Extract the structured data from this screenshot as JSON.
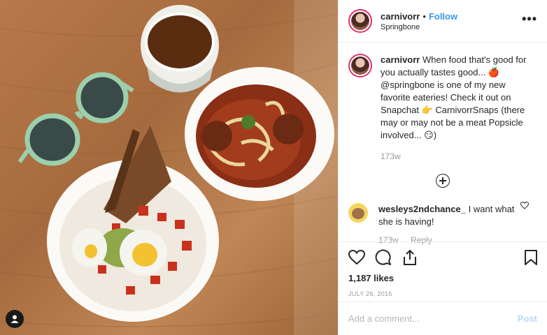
{
  "post": {
    "username": "carnivorr",
    "separator": "•",
    "follow_label": "Follow",
    "location": "Springbone",
    "more_label": "•••"
  },
  "caption": {
    "username": "carnivorr",
    "text": "When food that's good for you actually tastes good... 🍎 @springbone is one of my new favorite eateries! Check it out on Snapchat 👉 CarnivorrSnaps (there may or may not be a meat Popsicle involved... 😏)",
    "time": "173w"
  },
  "comments": [
    {
      "username": "wesleys2ndchance_",
      "text": "I want what she is having!",
      "time": "173w",
      "reply_label": "Reply"
    }
  ],
  "likes": "1,187 likes",
  "date": "JULY 26, 2016",
  "add_comment": {
    "placeholder": "Add a comment...",
    "post_label": "Post"
  },
  "icons": [
    "user-tag-icon",
    "more-icon",
    "load-more-icon",
    "comment-like-icon",
    "like-icon",
    "comment-icon",
    "share-icon",
    "bookmark-icon"
  ],
  "colors": {
    "link": "#3897f0",
    "muted": "#999999",
    "border": "#efefef",
    "post_disabled": "#b9dbfb"
  }
}
